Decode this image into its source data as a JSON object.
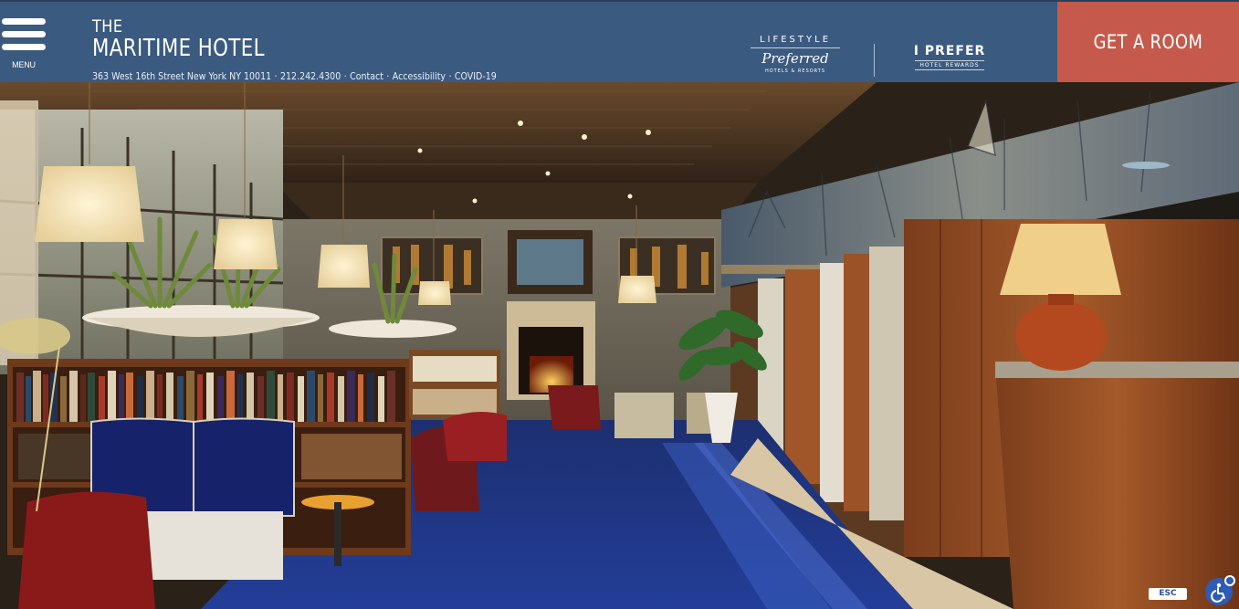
{
  "header": {
    "menu_label": "MENU",
    "brand_line1": "THE",
    "brand_line2": "MARITIME HOTEL",
    "address": "363 West 16th Street New York NY 10011",
    "phone": "212.242.4300",
    "links": [
      "Contact",
      "Accessibility",
      "COVID-19"
    ],
    "separator": "·",
    "partner_logo_1": {
      "top": "LIFESTYLE",
      "script": "Preferred",
      "sub": "HOTELS & RESORTS"
    },
    "partner_logo_2": {
      "top": "I PREFER",
      "sub": "HOTEL REWARDS"
    },
    "cta_label": "GET A ROOM"
  },
  "hero": {
    "description_icon": "hotel-lobby-photo"
  },
  "floating": {
    "esc_label": "ESC",
    "a11y_icon": "accessibility-icon"
  },
  "colors": {
    "header_bg": "#3b5a80",
    "cta_bg": "#c55a4c",
    "carpet": "#1f3a8a"
  }
}
